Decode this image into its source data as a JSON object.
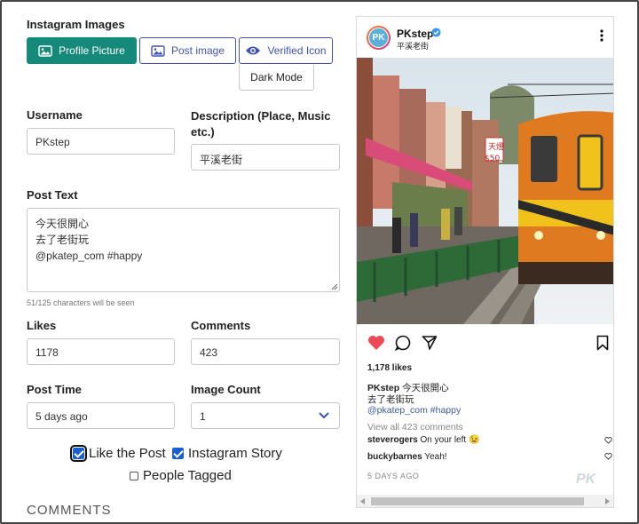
{
  "section": {
    "title": "Instagram Images"
  },
  "image_buttons": {
    "profile_picture": "Profile Picture",
    "post_image": "Post image",
    "verified_icon": "Verified Icon",
    "dark_mode": "Dark Mode"
  },
  "username": {
    "label": "Username",
    "value": "PKstep"
  },
  "description": {
    "label_line1": "Description (Place, Music",
    "label_line2": "etc.)",
    "value": "平溪老街"
  },
  "post_text": {
    "label": "Post Text",
    "value": "今天很開心\n去了老街玩\n@pkatep_com #happy",
    "char_count": "51/125 characters will be seen"
  },
  "likes": {
    "label": "Likes",
    "value": "1178"
  },
  "comments": {
    "label": "Comments",
    "value": "423"
  },
  "post_time": {
    "label": "Post Time",
    "value": "5 days ago"
  },
  "image_count": {
    "label": "Image Count",
    "value": "1"
  },
  "options": {
    "like_the_post": {
      "label": "Like the Post",
      "checked": true
    },
    "instagram_story": {
      "label": "Instagram Story",
      "checked": true
    },
    "people_tagged": {
      "label": "People Tagged",
      "checked": false
    }
  },
  "comments_heading": "COMMENTS",
  "preview": {
    "avatar_text": "PK",
    "username": "PKstep",
    "location": "平溪老街",
    "likes_text": "1,178 likes",
    "caption_user": "PKstep",
    "caption_line1": "今天很開心",
    "caption_line2": "去了老街玩",
    "caption_line3": "@pkatep_com #happy",
    "view_all": "View all 423 comments",
    "comment1_user": "steverogers",
    "comment1_text": "On your left 😉",
    "comment2_user": "buckybarnes",
    "comment2_text": "Yeah!",
    "time": "5 DAYS AGO",
    "sign1": "天燈",
    "sign2": "$50",
    "watermark": "PK"
  },
  "colors": {
    "accent": "#15897a",
    "primary": "#3f51b5",
    "heart": "#ed4956",
    "verified": "#3897f0"
  }
}
